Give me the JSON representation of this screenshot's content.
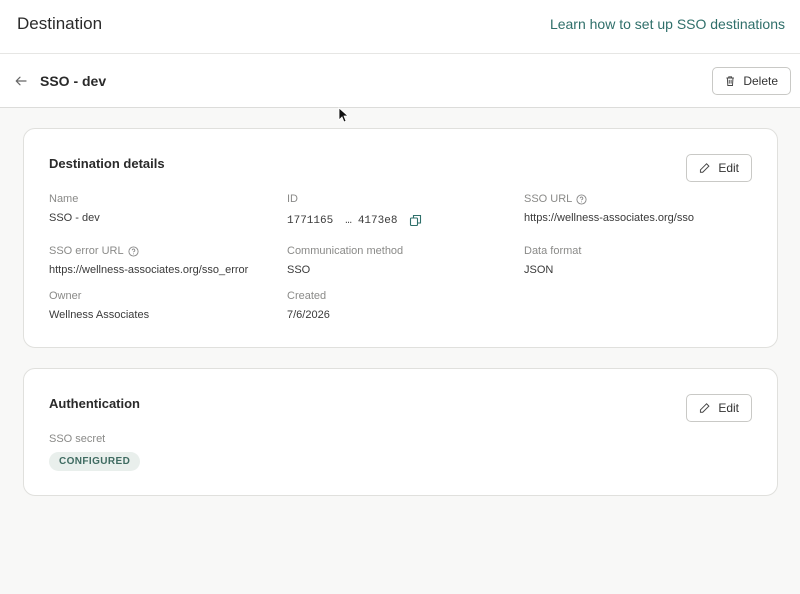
{
  "header": {
    "title": "Destination",
    "learn_link": "Learn how to set up SSO destinations"
  },
  "subheader": {
    "title": "SSO - dev",
    "delete_label": "Delete"
  },
  "details": {
    "heading": "Destination details",
    "edit_label": "Edit",
    "name": {
      "label": "Name",
      "value": "SSO - dev"
    },
    "id": {
      "label": "ID",
      "start": "1771165",
      "ellipsis": "…",
      "end": "4173e8"
    },
    "sso_url": {
      "label": "SSO URL",
      "value": "https://wellness-associates.org/sso"
    },
    "sso_error_url": {
      "label": "SSO error URL",
      "value": "https://wellness-associates.org/sso_error"
    },
    "communication_method": {
      "label": "Communication method",
      "value": "SSO"
    },
    "data_format": {
      "label": "Data format",
      "value": "JSON"
    },
    "owner": {
      "label": "Owner",
      "value": "Wellness Associates"
    },
    "created": {
      "label": "Created",
      "value": "7/6/2026"
    }
  },
  "authentication": {
    "heading": "Authentication",
    "edit_label": "Edit",
    "sso_secret": {
      "label": "SSO secret",
      "status": "CONFIGURED"
    }
  },
  "colors": {
    "link": "#2f6f6a",
    "badge_bg": "#e9efec",
    "badge_text": "#3f6b61"
  }
}
